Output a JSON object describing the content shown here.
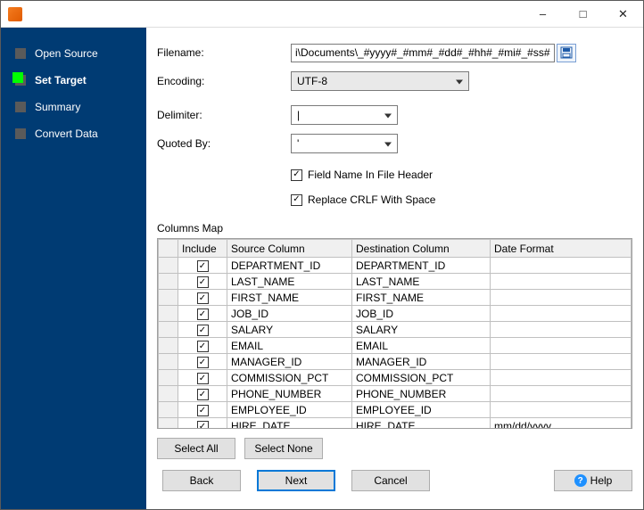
{
  "nav": {
    "items": [
      {
        "label": "Open Source"
      },
      {
        "label": "Set Target"
      },
      {
        "label": "Summary"
      },
      {
        "label": "Convert Data"
      }
    ]
  },
  "form": {
    "filename_label": "Filename:",
    "filename_value": "i\\Documents\\_#yyyy#_#mm#_#dd#_#hh#_#mi#_#ss#.txt",
    "encoding_label": "Encoding:",
    "encoding_value": "UTF-8",
    "delimiter_label": "Delimiter:",
    "delimiter_value": "|",
    "quoted_label": "Quoted By:",
    "quoted_value": "'",
    "cb_fieldname": "Field Name In File Header",
    "cb_replace": "Replace CRLF With Space"
  },
  "columns_map": {
    "title": "Columns Map",
    "headers": {
      "include": "Include",
      "source": "Source Column",
      "dest": "Destination Column",
      "date": "Date Format"
    },
    "rows": [
      {
        "src": "DEPARTMENT_ID",
        "dst": "DEPARTMENT_ID",
        "fmt": ""
      },
      {
        "src": "LAST_NAME",
        "dst": "LAST_NAME",
        "fmt": ""
      },
      {
        "src": "FIRST_NAME",
        "dst": "FIRST_NAME",
        "fmt": ""
      },
      {
        "src": "JOB_ID",
        "dst": "JOB_ID",
        "fmt": ""
      },
      {
        "src": "SALARY",
        "dst": "SALARY",
        "fmt": ""
      },
      {
        "src": "EMAIL",
        "dst": "EMAIL",
        "fmt": ""
      },
      {
        "src": "MANAGER_ID",
        "dst": "MANAGER_ID",
        "fmt": ""
      },
      {
        "src": "COMMISSION_PCT",
        "dst": "COMMISSION_PCT",
        "fmt": ""
      },
      {
        "src": "PHONE_NUMBER",
        "dst": "PHONE_NUMBER",
        "fmt": ""
      },
      {
        "src": "EMPLOYEE_ID",
        "dst": "EMPLOYEE_ID",
        "fmt": ""
      },
      {
        "src": "HIRE_DATE",
        "dst": "HIRE_DATE",
        "fmt": "mm/dd/yyyy"
      }
    ]
  },
  "buttons": {
    "select_all": "Select All",
    "select_none": "Select None",
    "back": "Back",
    "next": "Next",
    "cancel": "Cancel",
    "help": "Help"
  }
}
